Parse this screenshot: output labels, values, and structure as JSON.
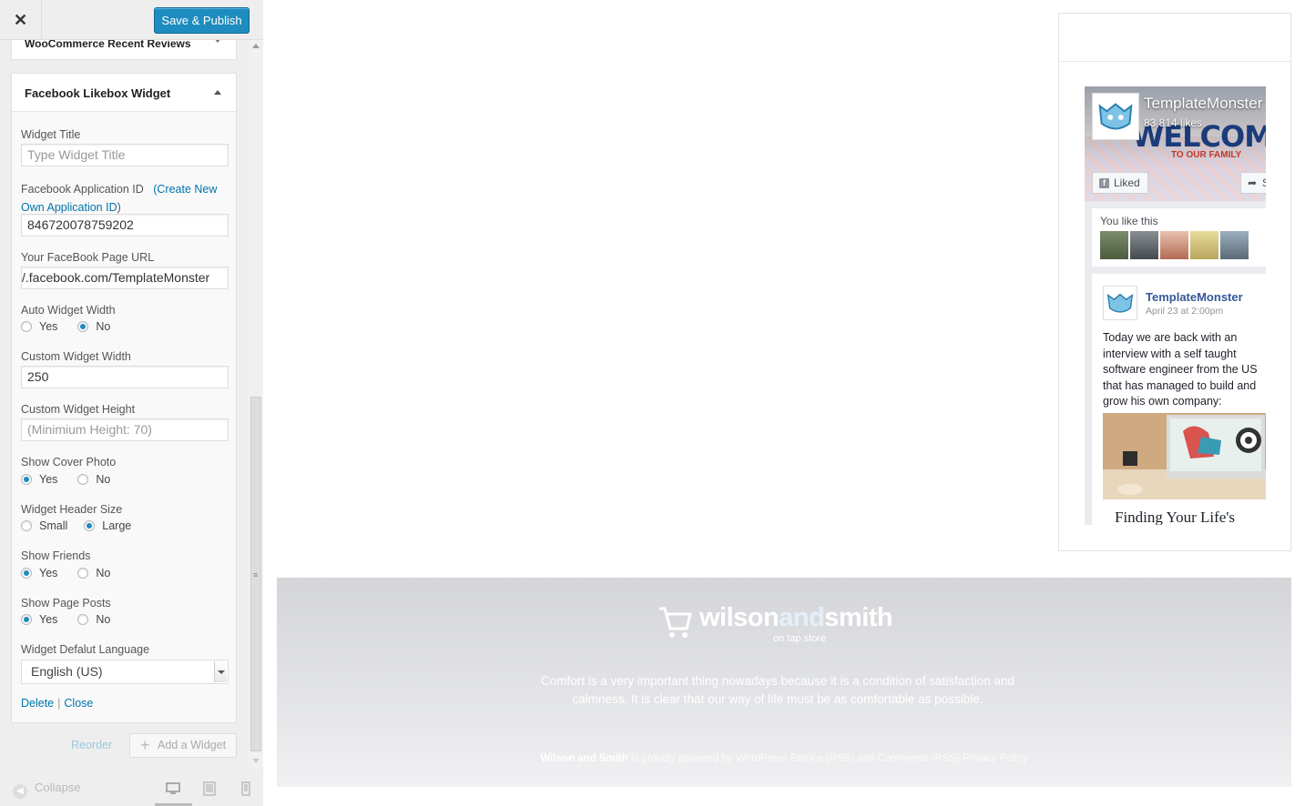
{
  "topbar": {
    "close_glyph": "✕",
    "save_label": "Save & Publish"
  },
  "widgets": {
    "collapsed_title": "WooCommerce Recent Reviews",
    "active_title": "Facebook Likebox Widget"
  },
  "form": {
    "title_label": "Widget Title",
    "title_placeholder": "Type Widget Title",
    "app_id_label": "Facebook Application ID",
    "app_id_link_open": "(",
    "app_id_link": "Create New Own Application ID",
    "app_id_link_close": ")",
    "app_id_value": "846720078759202",
    "page_url_label": "Your FaceBook Page URL",
    "page_url_value": "/.facebook.com/TemplateMonster",
    "auto_width_label": "Auto Widget Width",
    "custom_width_label": "Custom Widget Width",
    "custom_width_value": "250",
    "custom_height_label": "Custom Widget Height",
    "custom_height_placeholder": "(Minimium Height: 70)",
    "cover_label": "Show Cover Photo",
    "header_size_label": "Widget Header Size",
    "friends_label": "Show Friends",
    "posts_label": "Show Page Posts",
    "language_label": "Widget Defalut Language",
    "language_value": "English (US)",
    "yes": "Yes",
    "no": "No",
    "small": "Small",
    "large": "Large",
    "delete": "Delete",
    "sep": "|",
    "close": "Close",
    "selections": {
      "auto_width": "No",
      "cover": "Yes",
      "header_size": "Large",
      "friends": "Yes",
      "posts": "Yes"
    }
  },
  "panel_actions": {
    "reorder": "Reorder",
    "add_widget": "Add a Widget",
    "add_icon": "plus-icon"
  },
  "footer": {
    "collapse": "Collapse",
    "devices": [
      "desktop-icon",
      "tablet-icon",
      "mobile-icon"
    ],
    "active_device": "desktop"
  },
  "facebook": {
    "page_name": "TemplateMonster",
    "likes": "83,814 likes",
    "cover_headline": "WELCOM",
    "cover_sub": "TO OUR FAMILY",
    "liked": "Liked",
    "share": "S",
    "friends_text": "You like this",
    "post_author": "TemplateMonster",
    "post_date": "April 23 at 2:00pm",
    "post_text": "Today we are back with an interview with a self taught software engineer from the US that has managed to build and grow his own company:",
    "post_link_title": "Finding Your Life's"
  },
  "site_footer": {
    "logo_left": "wilson",
    "logo_mid": "and",
    "logo_right": "smith",
    "tagline": "on tap store",
    "description": "Comfort is a very important thing nowadays because it is a condition of satisfaction and calmness. It is clear that our way of life must be as comfortable as possible.",
    "copy_brand": "Wilson and Smith",
    "copy_rest": " is proudly powered by WordPress Entries (RSS) and Comments (RSS) Privacy Policy"
  },
  "colors": {
    "accent": "#1e8cbe",
    "link": "#0073aa",
    "fb_blue": "#365899"
  }
}
